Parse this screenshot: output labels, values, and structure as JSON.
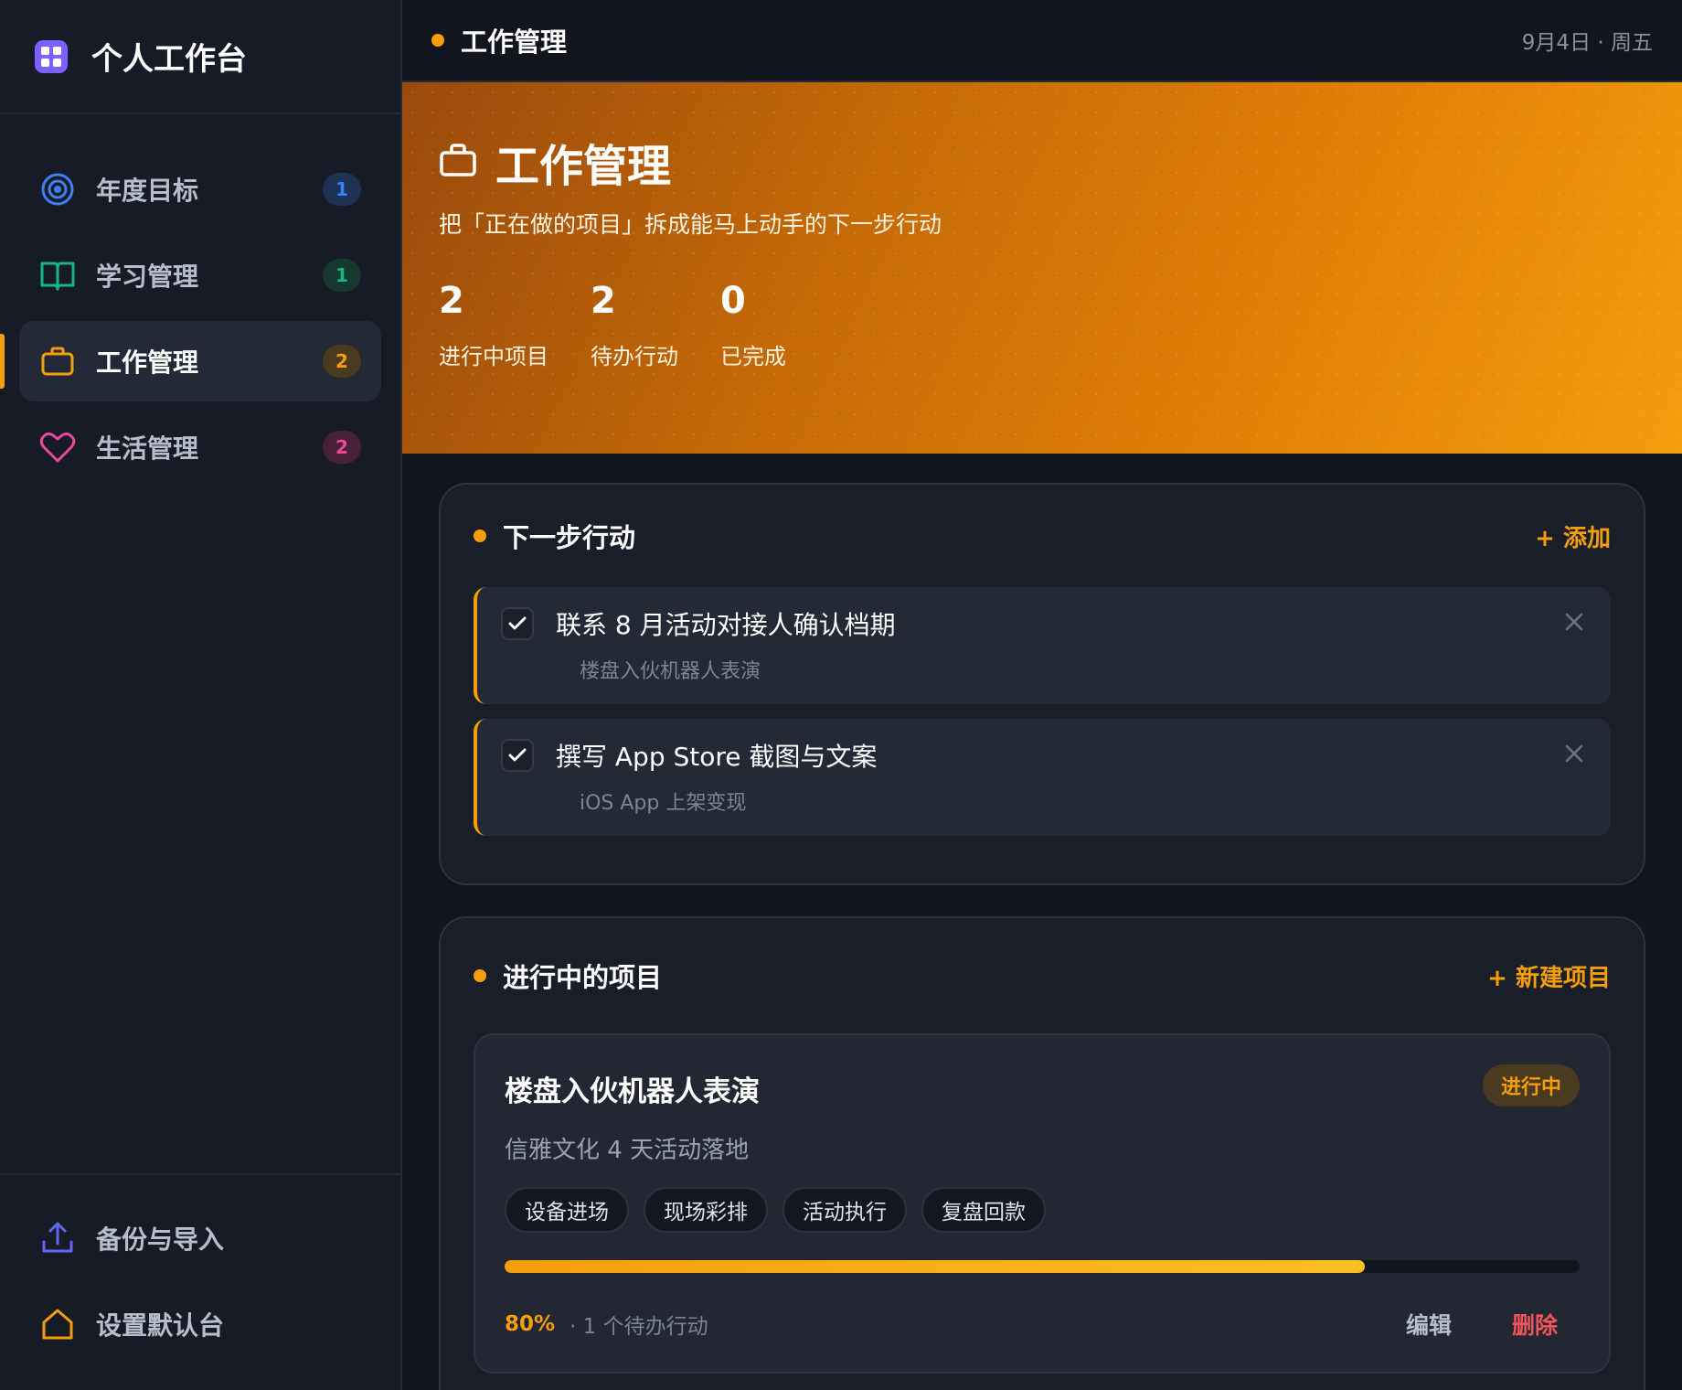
{
  "app": {
    "title": "个人工作台"
  },
  "sidebar": {
    "items": [
      {
        "label": "年度目标",
        "badge": "1",
        "icon": "target-icon",
        "color": "#3b82f6",
        "badge_bg": "#1e3354"
      },
      {
        "label": "学习管理",
        "badge": "1",
        "icon": "book-open-icon",
        "color": "#10b981",
        "badge_bg": "#16382f"
      },
      {
        "label": "工作管理",
        "badge": "2",
        "icon": "briefcase-icon",
        "color": "#f59e0b",
        "badge_bg": "#4a3a1f",
        "active": true
      },
      {
        "label": "生活管理",
        "badge": "2",
        "icon": "heart-icon",
        "color": "#ec4899",
        "badge_bg": "#4a2038"
      }
    ],
    "bottom": [
      {
        "label": "备份与导入",
        "icon": "upload-icon",
        "color": "#6366f1"
      },
      {
        "label": "设置默认台",
        "icon": "home-icon",
        "color": "#f59e0b"
      }
    ]
  },
  "topbar": {
    "title": "工作管理",
    "date": "9月4日 · 周五"
  },
  "hero": {
    "title": "工作管理",
    "subtitle": "把「正在做的项目」拆成能马上动手的下一步行动",
    "stats": [
      {
        "value": "2",
        "label": "进行中项目"
      },
      {
        "value": "2",
        "label": "待办行动"
      },
      {
        "value": "0",
        "label": "已完成"
      }
    ]
  },
  "next_actions": {
    "title": "下一步行动",
    "add_label": "+ 添加",
    "items": [
      {
        "title": "联系 8 月活动对接人确认档期",
        "project": "楼盘入伙机器人表演"
      },
      {
        "title": "撰写 App Store 截图与文案",
        "project": "iOS App 上架变现"
      }
    ]
  },
  "projects": {
    "title": "进行中的项目",
    "new_label": "+ 新建项目",
    "items": [
      {
        "title": "楼盘入伙机器人表演",
        "desc": "信雅文化 4 天活动落地",
        "status": "进行中",
        "tags": [
          "设备进场",
          "现场彩排",
          "活动执行",
          "复盘回款"
        ],
        "progress": 0.8,
        "progress_label": "80%",
        "pending": "· 1 个待办行动",
        "edit_label": "编辑",
        "delete_label": "删除"
      }
    ]
  },
  "colors": {
    "accent": "#f59e0b",
    "danger": "#f2545b",
    "bg": "#12151d",
    "sidebar_bg": "#171b25"
  }
}
